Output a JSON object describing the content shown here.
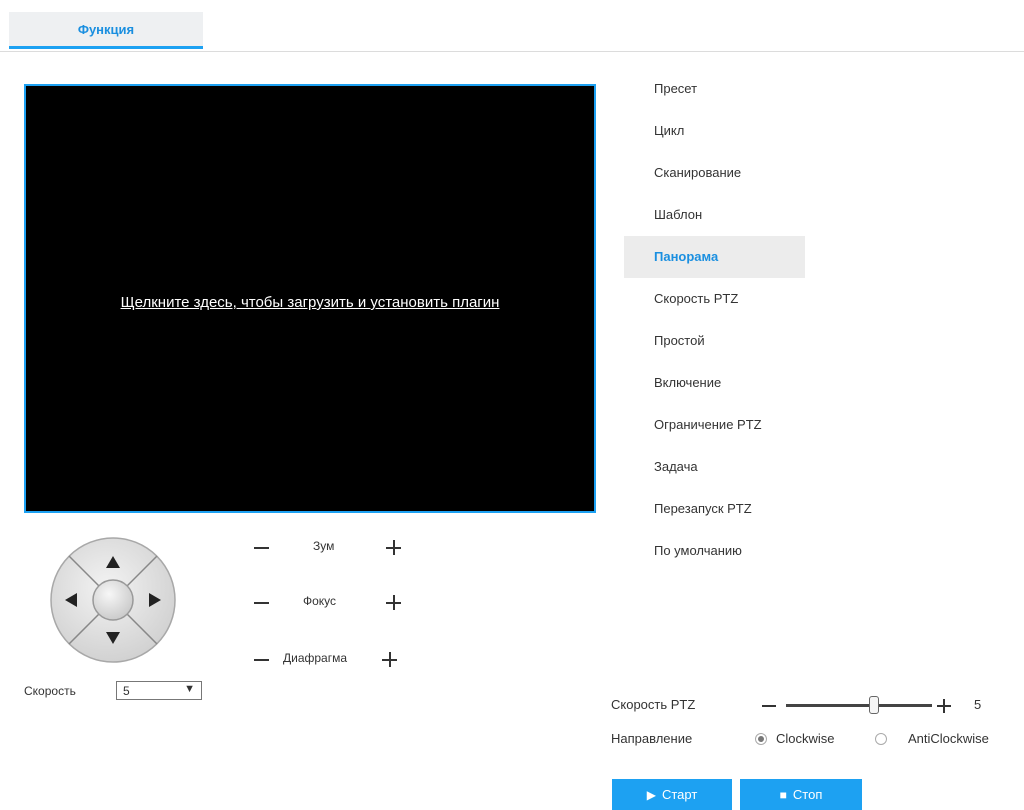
{
  "tabs": {
    "function_label": "Функция"
  },
  "video": {
    "plugin_link": "Щелкните здесь, чтобы загрузить и установить плагин"
  },
  "menu": {
    "items": [
      {
        "label": "Пресет"
      },
      {
        "label": "Цикл"
      },
      {
        "label": "Сканирование"
      },
      {
        "label": "Шаблон"
      },
      {
        "label": "Панорама",
        "active": true
      },
      {
        "label": "Скорость PTZ"
      },
      {
        "label": "Простой"
      },
      {
        "label": "Включение"
      },
      {
        "label": "Ограничение PTZ"
      },
      {
        "label": "Задача"
      },
      {
        "label": "Перезапуск PTZ"
      },
      {
        "label": "По умолчанию"
      }
    ]
  },
  "controls": {
    "zoom_label": "Зум",
    "focus_label": "Фокус",
    "iris_label": "Диафрагма",
    "speed_label": "Скорость",
    "speed_value": "5"
  },
  "panorama": {
    "ptz_speed_label": "Скорость PTZ",
    "ptz_speed_value": "5",
    "ptz_speed_fraction": 0.6,
    "direction_label": "Направление",
    "clockwise_label": "Clockwise",
    "anticlockwise_label": "AntiClockwise",
    "direction_selected": "clockwise",
    "start_label": "Старт",
    "stop_label": "Стоп"
  },
  "colors": {
    "accent": "#1da1f2",
    "accent_text": "#1a8fe0"
  },
  "icons": [
    "arrow-up-icon",
    "arrow-down-icon",
    "arrow-left-icon",
    "arrow-right-icon",
    "play-icon",
    "stop-icon"
  ]
}
